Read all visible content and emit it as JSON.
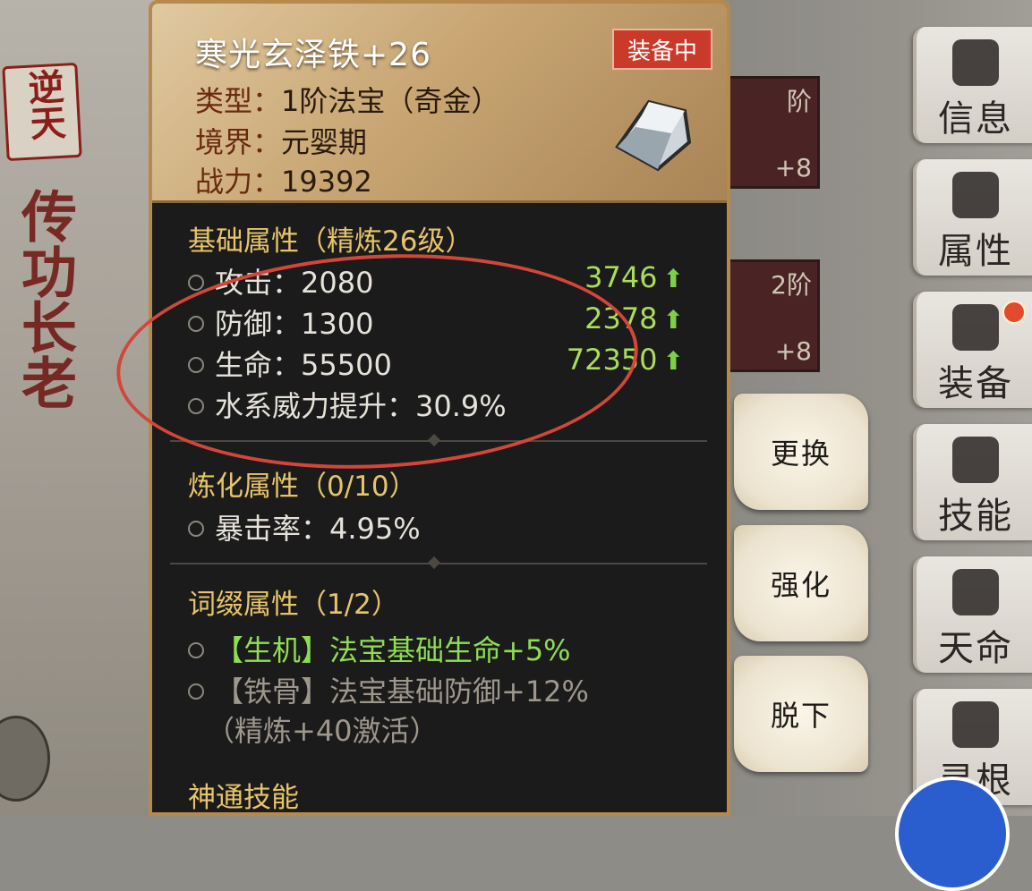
{
  "left_bg": {
    "seal_text": "逆天",
    "master_name": "传功长老"
  },
  "item": {
    "name": "寒光玄泽铁+26",
    "status_badge": "装备中",
    "type_label": "类型：",
    "type_value": "1阶法宝（奇金）",
    "realm_label": "境界：",
    "realm_value": "元婴期",
    "power_label": "战力：",
    "power_value": "19392"
  },
  "base_attributes": {
    "title": "基础属性（精炼26级）",
    "rows": [
      {
        "label": "攻击：2080",
        "upgrade": "3746"
      },
      {
        "label": "防御：1300",
        "upgrade": "2378"
      },
      {
        "label": "生命：55500",
        "upgrade": "72350"
      },
      {
        "label": "水系威力提升：30.9%",
        "upgrade": ""
      }
    ]
  },
  "refine_attributes": {
    "title": "炼化属性（0/10）",
    "rows": [
      {
        "label": "暴击率：4.95%"
      }
    ]
  },
  "affix_attributes": {
    "title": "词缀属性（1/2）",
    "rows": [
      {
        "label": "【生机】法宝基础生命+5%",
        "active": true
      },
      {
        "label": "【铁骨】法宝基础防御+12%",
        "active": false
      }
    ],
    "locked_note": "（精炼+40激活）"
  },
  "next_section_partial": "神通技能",
  "actions": {
    "replace": "更换",
    "enhance": "强化",
    "unequip": "脱下"
  },
  "side_tabs": [
    "信息",
    "属性",
    "装备",
    "技能",
    "天命",
    "灵根"
  ],
  "equip_slots": [
    {
      "level": "阶",
      "plus": "+8"
    },
    {
      "level": "2阶",
      "plus": "+8"
    }
  ],
  "colors": {
    "panel_bg": "#1b1b1c",
    "gold_title": "#e6c46a",
    "upgrade_green": "#a9dd5a",
    "badge_red": "#c93a2a",
    "annotation_red": "#d3463a"
  }
}
